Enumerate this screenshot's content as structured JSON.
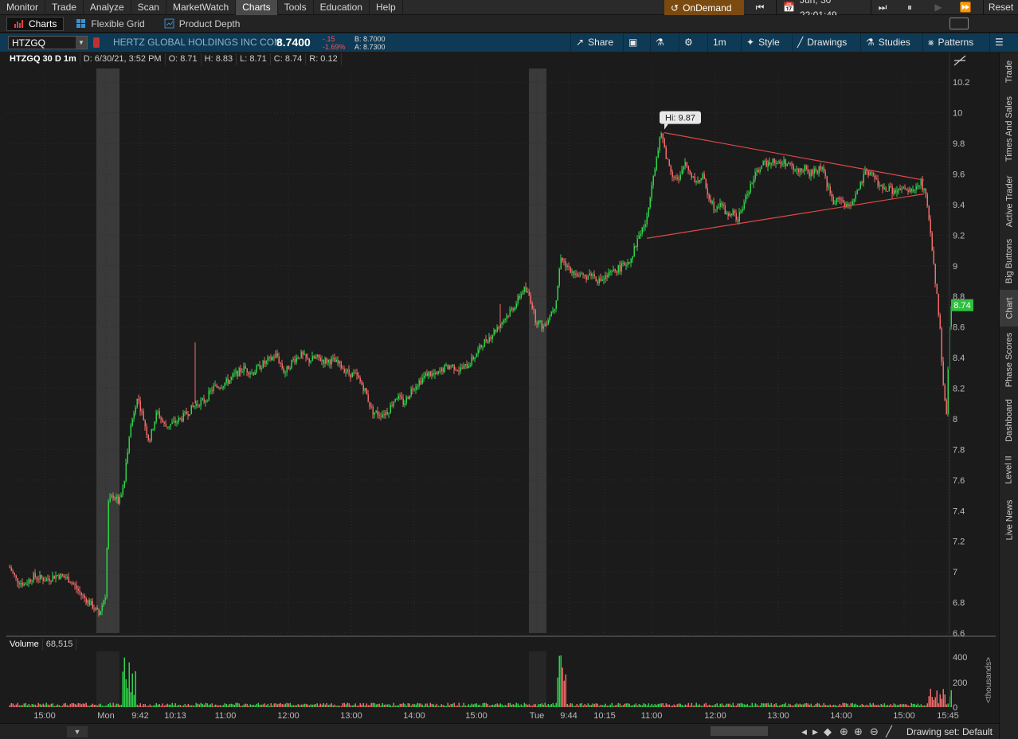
{
  "menu": {
    "items": [
      "Monitor",
      "Trade",
      "Analyze",
      "Scan",
      "MarketWatch",
      "Charts",
      "Tools",
      "Education",
      "Help"
    ],
    "active": "Charts",
    "ondemand_label": "OnDemand",
    "datetime": "Jun, 30 22:01:49",
    "reset_label": "Reset"
  },
  "tabs": {
    "items": [
      "Charts",
      "Flexible Grid",
      "Product Depth"
    ],
    "active": "Charts"
  },
  "symbol_bar": {
    "symbol": "HTZGQ",
    "company": "HERTZ GLOBAL HOLDINGS INC COM",
    "last": "8.7400",
    "change": "-.15",
    "change_pct": "-1.69%",
    "bid": "B: 8.7000",
    "ask": "A: 8.7300",
    "share_label": "Share",
    "aggregation_label": "1m",
    "style_label": "Style",
    "drawings_label": "Drawings",
    "studies_label": "Studies",
    "patterns_label": "Patterns"
  },
  "info": {
    "symbol_period": "HTZGQ 30 D 1m",
    "date": "D: 6/30/21, 3:52 PM",
    "open": "O: 8.71",
    "high": "H: 8.83",
    "low": "L: 8.71",
    "close": "C: 8.74",
    "range": "R: 0.12"
  },
  "volume": {
    "label": "Volume",
    "value": "68,515",
    "unit_label": "<thousands>",
    "ticks": [
      "400",
      "200",
      "0"
    ]
  },
  "colors": {
    "up": "#2fd34a",
    "down": "#f26b6b",
    "trendline": "#e04848",
    "current_price_bg": "#2fbf3f",
    "session_shade": "#3a3a3a"
  },
  "right_tabs": [
    "Trade",
    "Times And Sales",
    "Active Trader",
    "Big Buttons",
    "Chart",
    "Phase Scores",
    "Dashboard",
    "Level II",
    "Live News"
  ],
  "right_tabs_active": "Chart",
  "drawing_set": "Drawing set: Default",
  "chart_data": {
    "type": "candlestick",
    "ylim": [
      6.6,
      10.3
    ],
    "y_ticks": [
      "10.2",
      "10",
      "9.8",
      "9.6",
      "9.4",
      "9.2",
      "9",
      "8.8",
      "8.6",
      "8.4",
      "8.2",
      "8",
      "7.8",
      "7.6",
      "7.4",
      "7.2",
      "7",
      "6.8",
      "6.6"
    ],
    "x_ticks": [
      "15:00",
      "Mon",
      "9:42",
      "10:13",
      "11:00",
      "12:00",
      "13:00",
      "14:00",
      "15:00",
      "Tue",
      "9:44",
      "10:15",
      "11:00",
      "12:00",
      "13:00",
      "14:00",
      "15:00",
      "15:45"
    ],
    "current_price_label": "8.74",
    "high_annotation": "Hi: 9.87",
    "price_path": [
      [
        0,
        7.03
      ],
      [
        8,
        6.95
      ],
      [
        18,
        6.92
      ],
      [
        30,
        6.97
      ],
      [
        45,
        6.95
      ],
      [
        60,
        6.98
      ],
      [
        75,
        6.95
      ],
      [
        90,
        6.85
      ],
      [
        105,
        6.77
      ],
      [
        112,
        6.72
      ],
      [
        120,
        6.85
      ],
      [
        124,
        7.45
      ],
      [
        130,
        7.5
      ],
      [
        137,
        7.45
      ],
      [
        143,
        7.55
      ],
      [
        150,
        7.9
      ],
      [
        160,
        8.15
      ],
      [
        168,
        8.0
      ],
      [
        175,
        7.85
      ],
      [
        185,
        8.05
      ],
      [
        195,
        7.95
      ],
      [
        205,
        7.97
      ],
      [
        215,
        8.0
      ],
      [
        225,
        8.05
      ],
      [
        235,
        8.1
      ],
      [
        245,
        8.12
      ],
      [
        255,
        8.2
      ],
      [
        265,
        8.22
      ],
      [
        275,
        8.25
      ],
      [
        285,
        8.3
      ],
      [
        295,
        8.33
      ],
      [
        305,
        8.3
      ],
      [
        315,
        8.35
      ],
      [
        325,
        8.38
      ],
      [
        335,
        8.42
      ],
      [
        345,
        8.3
      ],
      [
        355,
        8.38
      ],
      [
        365,
        8.42
      ],
      [
        375,
        8.38
      ],
      [
        385,
        8.4
      ],
      [
        395,
        8.38
      ],
      [
        405,
        8.38
      ],
      [
        415,
        8.35
      ],
      [
        425,
        8.3
      ],
      [
        435,
        8.28
      ],
      [
        445,
        8.2
      ],
      [
        455,
        8.05
      ],
      [
        465,
        8.03
      ],
      [
        475,
        8.05
      ],
      [
        485,
        8.15
      ],
      [
        495,
        8.1
      ],
      [
        505,
        8.2
      ],
      [
        515,
        8.25
      ],
      [
        525,
        8.3
      ],
      [
        535,
        8.28
      ],
      [
        545,
        8.33
      ],
      [
        555,
        8.35
      ],
      [
        565,
        8.32
      ],
      [
        575,
        8.35
      ],
      [
        585,
        8.42
      ],
      [
        595,
        8.5
      ],
      [
        605,
        8.55
      ],
      [
        615,
        8.62
      ],
      [
        625,
        8.68
      ],
      [
        635,
        8.75
      ],
      [
        645,
        8.85
      ],
      [
        653,
        8.8
      ],
      [
        660,
        8.65
      ],
      [
        670,
        8.6
      ],
      [
        685,
        8.75
      ],
      [
        692,
        9.05
      ],
      [
        700,
        9.0
      ],
      [
        710,
        8.95
      ],
      [
        720,
        8.92
      ],
      [
        730,
        8.95
      ],
      [
        740,
        8.9
      ],
      [
        750,
        8.93
      ],
      [
        760,
        8.97
      ],
      [
        770,
        9.0
      ],
      [
        780,
        9.05
      ],
      [
        790,
        9.2
      ],
      [
        800,
        9.3
      ],
      [
        806,
        9.55
      ],
      [
        812,
        9.7
      ],
      [
        818,
        9.87
      ],
      [
        825,
        9.7
      ],
      [
        832,
        9.6
      ],
      [
        840,
        9.55
      ],
      [
        848,
        9.68
      ],
      [
        855,
        9.6
      ],
      [
        862,
        9.55
      ],
      [
        870,
        9.58
      ],
      [
        878,
        9.45
      ],
      [
        885,
        9.38
      ],
      [
        892,
        9.42
      ],
      [
        900,
        9.33
      ],
      [
        907,
        9.35
      ],
      [
        914,
        9.3
      ],
      [
        921,
        9.4
      ],
      [
        928,
        9.5
      ],
      [
        935,
        9.58
      ],
      [
        942,
        9.65
      ],
      [
        950,
        9.67
      ],
      [
        958,
        9.7
      ],
      [
        965,
        9.66
      ],
      [
        972,
        9.68
      ],
      [
        980,
        9.65
      ],
      [
        988,
        9.62
      ],
      [
        996,
        9.64
      ],
      [
        1004,
        9.6
      ],
      [
        1012,
        9.62
      ],
      [
        1020,
        9.65
      ],
      [
        1028,
        9.5
      ],
      [
        1035,
        9.4
      ],
      [
        1042,
        9.45
      ],
      [
        1050,
        9.38
      ],
      [
        1058,
        9.43
      ],
      [
        1066,
        9.5
      ],
      [
        1074,
        9.6
      ],
      [
        1080,
        9.62
      ],
      [
        1088,
        9.55
      ],
      [
        1096,
        9.5
      ],
      [
        1104,
        9.5
      ],
      [
        1112,
        9.48
      ],
      [
        1120,
        9.5
      ],
      [
        1128,
        9.48
      ],
      [
        1136,
        9.5
      ],
      [
        1144,
        9.55
      ],
      [
        1150,
        9.45
      ],
      [
        1156,
        9.2
      ],
      [
        1162,
        8.9
      ],
      [
        1168,
        8.6
      ],
      [
        1172,
        8.2
      ],
      [
        1176,
        8.05
      ],
      [
        1180,
        8.6
      ],
      [
        1182,
        8.74
      ]
    ],
    "trendlines": [
      {
        "from": [
          800,
          9.18
        ],
        "to": [
          1148,
          9.47
        ]
      },
      {
        "from": [
          822,
          9.87
        ],
        "to": [
          1148,
          9.56
        ]
      }
    ],
    "gap_sessions": [
      "Mon",
      "Tue"
    ]
  }
}
